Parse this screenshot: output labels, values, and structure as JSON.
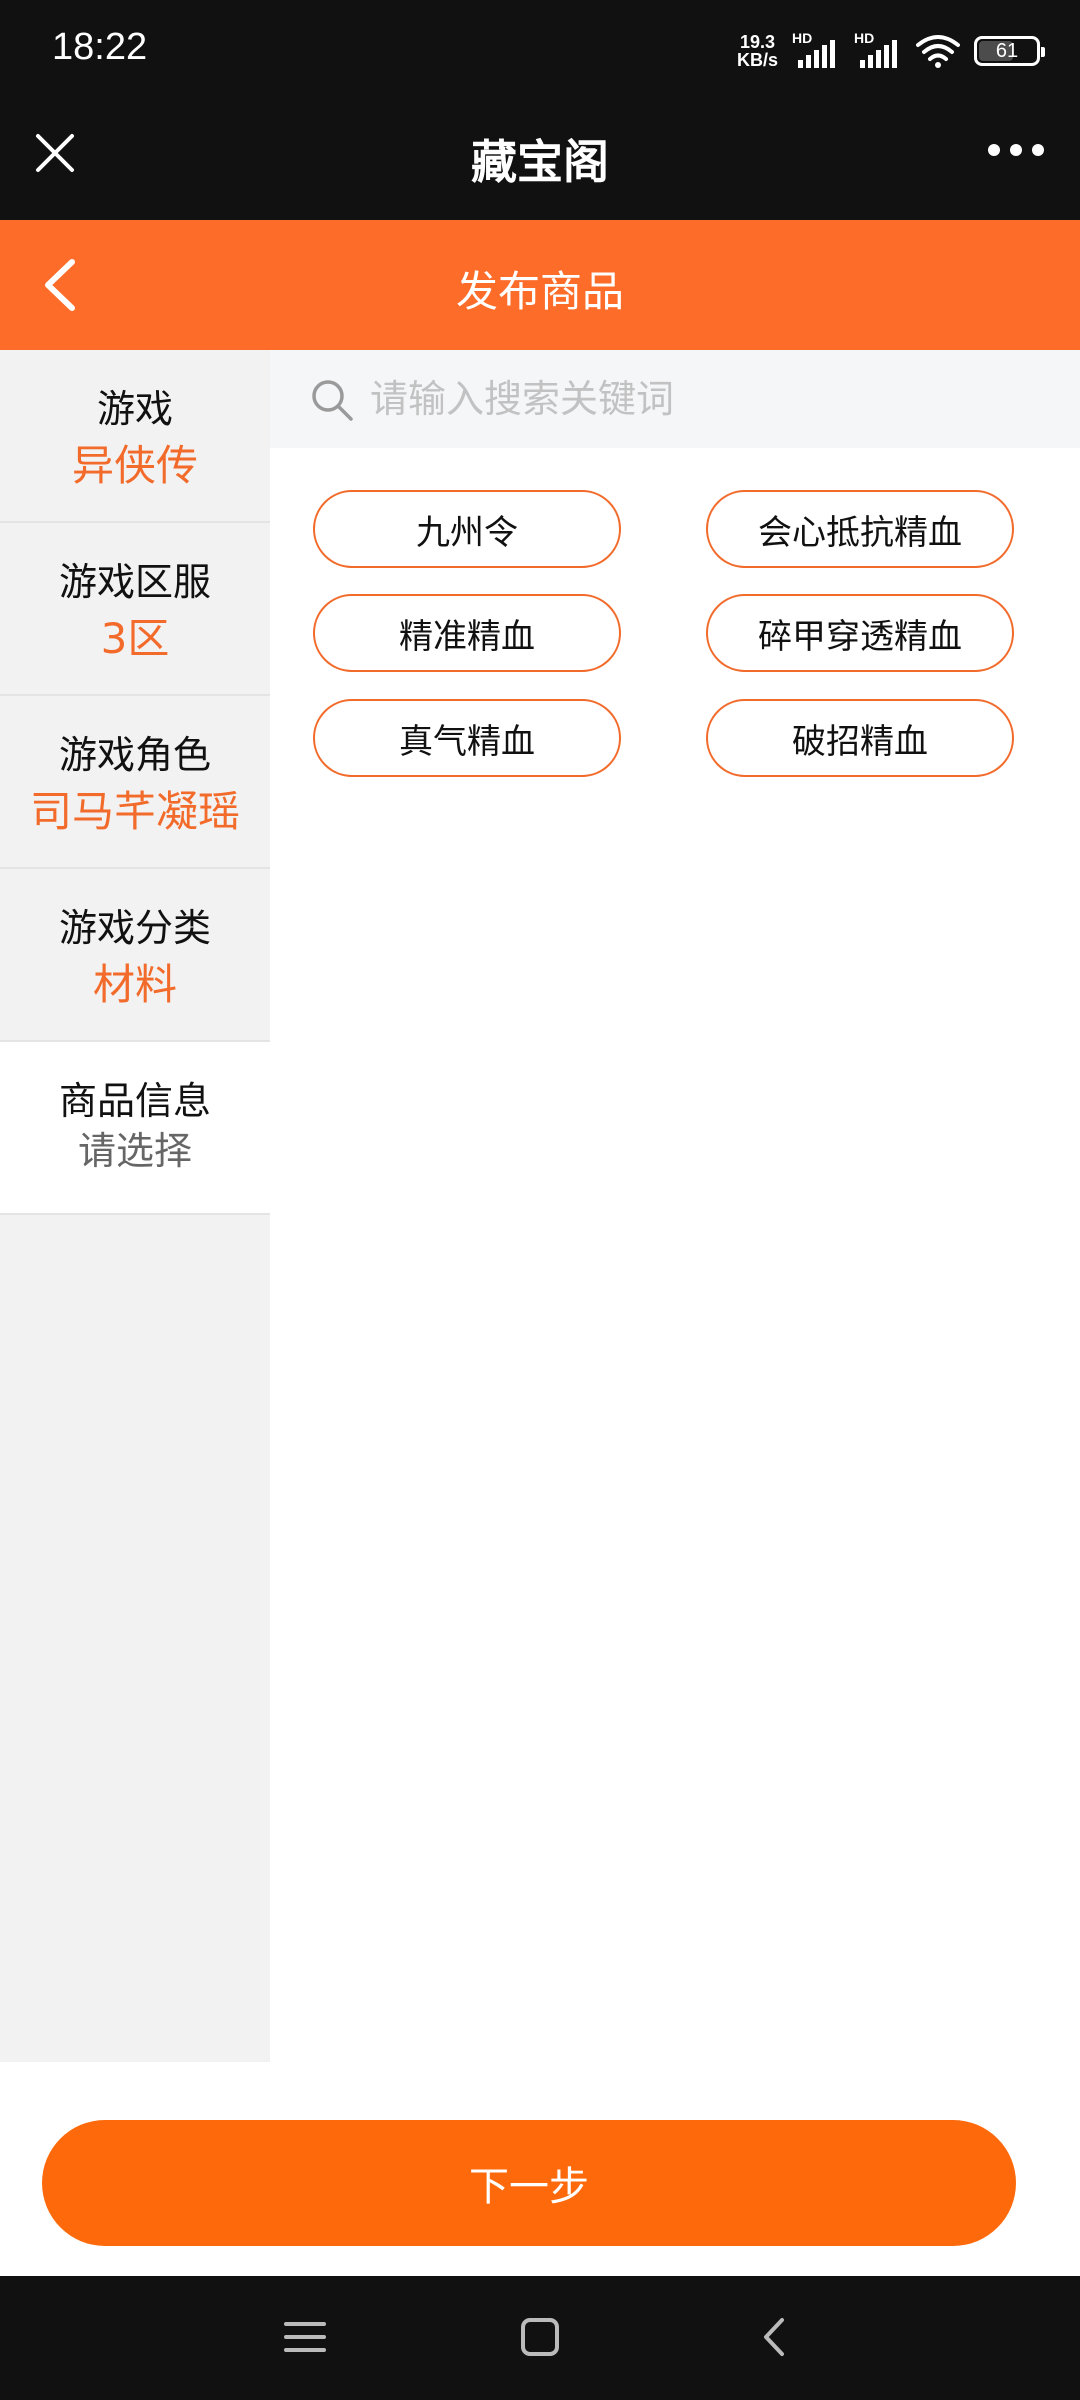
{
  "status_bar": {
    "time": "18:22",
    "net_speed_value": "19.3",
    "net_speed_unit": "KB/s",
    "sim1_label": "HD",
    "sim2_label": "HD",
    "battery": "61",
    "battery_level": 0.61
  },
  "mini_program": {
    "title": "藏宝阁"
  },
  "header": {
    "title": "发布商品"
  },
  "sidebar": {
    "items": [
      {
        "label": "游戏",
        "value": "异侠传"
      },
      {
        "label": "游戏区服",
        "value": "3区"
      },
      {
        "label": "游戏角色",
        "value": "司马芊凝瑶"
      },
      {
        "label": "游戏分类",
        "value": "材料"
      },
      {
        "label": "商品信息",
        "value": "请选择"
      }
    ]
  },
  "search": {
    "placeholder": "请输入搜索关键词",
    "value": ""
  },
  "options": [
    "九州令",
    "会心抵抗精血",
    "精准精血",
    "碎甲穿透精血",
    "真气精血",
    "破招精血"
  ],
  "footer": {
    "next_label": "下一步"
  },
  "colors": {
    "accent": "#FE6C2A",
    "button": "#FE6A0B",
    "value_text": "#F26B2B"
  },
  "icons": {
    "close": "close-icon",
    "more": "more-dots-icon",
    "back": "chevron-left-icon",
    "search": "search-icon",
    "menu": "menu-icon",
    "home": "home-square-icon",
    "nav_back": "nav-back-icon"
  }
}
